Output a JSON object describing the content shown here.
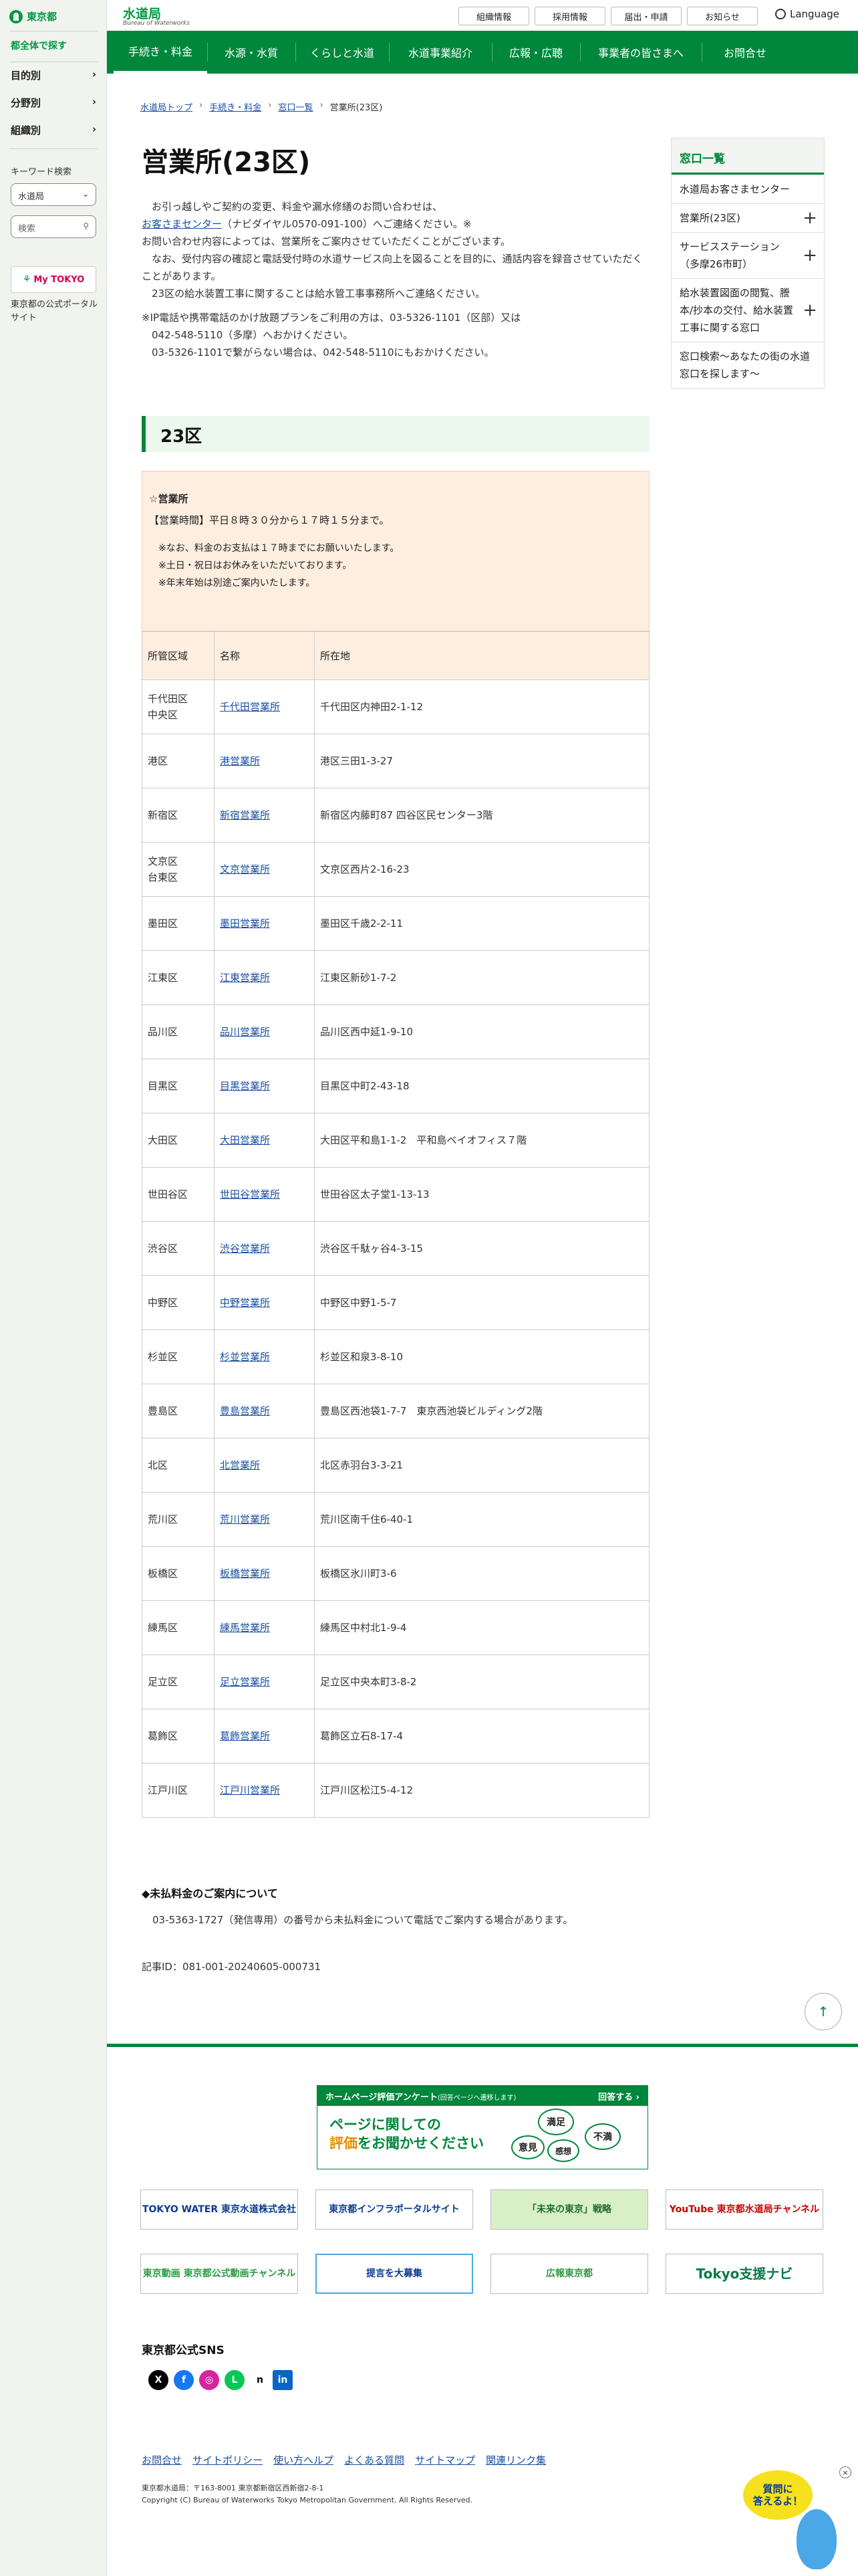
{
  "sidebar": {
    "logo": "東京都",
    "find_label": "都全体で探す",
    "nav": [
      "目的別",
      "分野別",
      "組織別"
    ],
    "keyword_label": "キーワード検索",
    "scope_value": "水道局",
    "search_placeholder": "検索",
    "mytokyo": "My TOKYO",
    "mytokyo_desc": "東京都の公式ポータルサイト"
  },
  "header": {
    "title": "水道局",
    "subtitle": "Bureau of Waterworks",
    "utility": [
      "組織情報",
      "採用情報",
      "届出・申請",
      "お知らせ"
    ],
    "language": "Language"
  },
  "gnav": [
    "手続き・料金",
    "水源・水質",
    "くらしと水道",
    "水道事業紹介",
    "広報・広聴",
    "事業者の皆さまへ",
    "お問合せ"
  ],
  "breadcrumb": [
    "水道局トップ",
    "手続き・料金",
    "窓口一覧",
    "営業所(23区)"
  ],
  "page": {
    "title": "営業所(23区)",
    "intro": [
      "　お引っ越しやご契約の変更、料金や漏水修繕のお問い合わせは、",
      "お問い合わせ内容によっては、営業所をご案内させていただくことがございます。",
      "　なお、受付内容の確認と電話受付時の水道サービス向上を図ることを目的に、通話内容を録音させていただくことがあります。",
      "　23区の給水装置工事に関することは給水管工事事務所へご連絡ください。"
    ],
    "intro_link": "お客さまセンター",
    "intro_link_tail": "（ナビダイヤル0570-091-100）へご連絡ください。※",
    "ip_note": [
      "※IP電話や携帯電話のかけ放題プランをご利用の方は、03-5326-1101（区部）又は",
      "　042-548-5110（多摩）へおかけください。",
      "　03-5326-1101で繋がらない場合は、042-548-5110にもおかけください。"
    ],
    "section": "23区",
    "hours": {
      "heading": "☆営業所",
      "time": "【営業時間】平日８時３０分から１７時１５分まで。",
      "notes": [
        "※なお、料金のお支払は１７時までにお願いいたします。",
        "※土日・祝日はお休みをいただいております。",
        "※年末年始は別途ご案内いたします。"
      ]
    },
    "table": {
      "headers": [
        "所管区域",
        "名称",
        "所在地"
      ],
      "rows": [
        {
          "area": "千代田区\n中央区",
          "name": "千代田営業所",
          "addr": "千代田区内神田2-1-12"
        },
        {
          "area": "港区",
          "name": "港営業所",
          "addr": "港区三田1-3-27"
        },
        {
          "area": "新宿区",
          "name": "新宿営業所",
          "addr": "新宿区内藤町87 四谷区民センター3階"
        },
        {
          "area": "文京区\n台東区",
          "name": "文京営業所",
          "addr": "文京区西片2-16-23"
        },
        {
          "area": "墨田区",
          "name": "墨田営業所",
          "addr": "墨田区千歳2-2-11"
        },
        {
          "area": "江東区",
          "name": "江東営業所",
          "addr": "江東区新砂1-7-2"
        },
        {
          "area": "品川区",
          "name": "品川営業所",
          "addr": "品川区西中延1-9-10"
        },
        {
          "area": "目黒区",
          "name": "目黒営業所",
          "addr": "目黒区中町2-43-18"
        },
        {
          "area": "大田区",
          "name": "大田営業所",
          "addr": "大田区平和島1-1-2　平和島ベイオフィス７階"
        },
        {
          "area": "世田谷区",
          "name": "世田谷営業所",
          "addr": "世田谷区太子堂1-13-13"
        },
        {
          "area": "渋谷区",
          "name": "渋谷営業所",
          "addr": "渋谷区千駄ヶ谷4-3-15"
        },
        {
          "area": "中野区",
          "name": "中野営業所",
          "addr": "中野区中野1-5-7"
        },
        {
          "area": "杉並区",
          "name": "杉並営業所",
          "addr": "杉並区和泉3-8-10"
        },
        {
          "area": "豊島区",
          "name": "豊島営業所",
          "addr": "豊島区西池袋1-7-7　東京西池袋ビルディング2階"
        },
        {
          "area": "北区",
          "name": "北営業所",
          "addr": "北区赤羽台3-3-21"
        },
        {
          "area": "荒川区",
          "name": "荒川営業所",
          "addr": "荒川区南千住6-40-1"
        },
        {
          "area": "板橋区",
          "name": "板橋営業所",
          "addr": "板橋区氷川町3-6"
        },
        {
          "area": "練馬区",
          "name": "練馬営業所",
          "addr": "練馬区中村北1-9-4"
        },
        {
          "area": "足立区",
          "name": "足立営業所",
          "addr": "足立区中央本町3-8-2"
        },
        {
          "area": "葛飾区",
          "name": "葛飾営業所",
          "addr": "葛飾区立石8-17-4"
        },
        {
          "area": "江戸川区",
          "name": "江戸川営業所",
          "addr": "江戸川区松江5-4-12"
        }
      ]
    },
    "unpaid_heading": "◆未払料金のご案内について",
    "unpaid_text": "03-5363-1727（発信専用）の番号から未払料金について電話でご案内する場合があります。",
    "article_id": "記事ID：081-001-20240605-000731"
  },
  "right_panel": {
    "heading": "窓口一覧",
    "items": [
      {
        "label": "水道局お客さまセンター",
        "expand": false
      },
      {
        "label": "営業所(23区)",
        "expand": true
      },
      {
        "label": "サービスステーション（多摩26市町）",
        "expand": true
      },
      {
        "label": "給水装置図面の閲覧、謄本/抄本の交付、給水装置工事に関する窓口",
        "expand": true
      },
      {
        "label": "窓口検索～あなたの街の水道窓口を探します～",
        "expand": false
      }
    ]
  },
  "footer": {
    "survey_top": "ホームページ評価アンケート",
    "survey_top_small": "(回答ページへ遷移します)",
    "survey_answer": "回答する ›",
    "survey_line1": "ページに関しての",
    "survey_line2a": "評価",
    "survey_line2b": "をお聞かせください",
    "bubbles": [
      "満足",
      "意見",
      "感想",
      "不満"
    ],
    "banners": [
      "TOKYO WATER 東京水道株式会社",
      "東京都インフラポータルサイト",
      "「未来の東京」戦略",
      "YouTube 東京都水道局チャンネル",
      "東京動画 東京都公式動画チャンネル",
      "提言を大募集",
      "広報東京都",
      "Tokyo支援ナビ"
    ],
    "sns_heading": "東京都公式SNS",
    "sns": [
      "X",
      "f",
      "◎",
      "L",
      "n",
      "in"
    ],
    "links": [
      "お問合せ",
      "サイトポリシー",
      "使い方ヘルプ",
      "よくある質問",
      "サイトマップ",
      "関連リンク集"
    ],
    "address": "東京都水道局：〒163-8001 東京都新宿区西新宿2-8-1",
    "copyright": "Copyright (C) Bureau of Waterworks Tokyo Metropolitan Government. All Rights Reserved.",
    "mascot": "質問に\n答えるよ！",
    "totop": "↑"
  },
  "colors": {
    "brand_green": "#00873c",
    "peach": "#fdeee0",
    "link": "#1a4fa0"
  }
}
